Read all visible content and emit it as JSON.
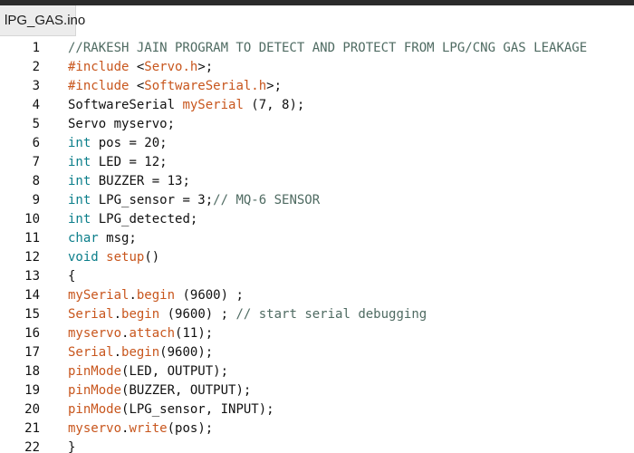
{
  "tab": {
    "title": "lPG_GAS.ino"
  },
  "colors": {
    "comment": "#4f6b62",
    "keyword": "#0b7e8a",
    "function": "#c8561d",
    "plain": "#111111",
    "tab_bg": "#ececec",
    "topbar": "#2b2b2b"
  },
  "lines": [
    {
      "n": "1",
      "tokens": [
        {
          "t": "c",
          "s": "//RAKESH JAIN PROGRAM TO DETECT AND PROTECT FROM LPG/CNG GAS LEAKAGE"
        }
      ]
    },
    {
      "n": "2",
      "tokens": [
        {
          "t": "f",
          "s": "#include"
        },
        {
          "t": "p",
          "s": " <"
        },
        {
          "t": "f",
          "s": "Servo.h"
        },
        {
          "t": "p",
          "s": ">;"
        }
      ]
    },
    {
      "n": "3",
      "tokens": [
        {
          "t": "f",
          "s": "#include"
        },
        {
          "t": "p",
          "s": " <"
        },
        {
          "t": "f",
          "s": "SoftwareSerial.h"
        },
        {
          "t": "p",
          "s": ">;"
        }
      ]
    },
    {
      "n": "4",
      "tokens": [
        {
          "t": "p",
          "s": "SoftwareSerial "
        },
        {
          "t": "f",
          "s": "mySerial"
        },
        {
          "t": "p",
          "s": " (7, 8);"
        }
      ]
    },
    {
      "n": "5",
      "tokens": [
        {
          "t": "p",
          "s": "Servo myservo;"
        }
      ]
    },
    {
      "n": "6",
      "tokens": [
        {
          "t": "k",
          "s": "int"
        },
        {
          "t": "p",
          "s": " pos = 20;"
        }
      ]
    },
    {
      "n": "7",
      "tokens": [
        {
          "t": "k",
          "s": "int"
        },
        {
          "t": "p",
          "s": " LED = 12;"
        }
      ]
    },
    {
      "n": "8",
      "tokens": [
        {
          "t": "k",
          "s": "int"
        },
        {
          "t": "p",
          "s": " BUZZER = 13;"
        }
      ]
    },
    {
      "n": "9",
      "tokens": [
        {
          "t": "k",
          "s": "int"
        },
        {
          "t": "p",
          "s": " LPG_sensor = 3;"
        },
        {
          "t": "c",
          "s": "// MQ-6 SENSOR"
        }
      ]
    },
    {
      "n": "10",
      "tokens": [
        {
          "t": "k",
          "s": "int"
        },
        {
          "t": "p",
          "s": " LPG_detected;"
        }
      ]
    },
    {
      "n": "11",
      "tokens": [
        {
          "t": "k",
          "s": "char"
        },
        {
          "t": "p",
          "s": " msg;"
        }
      ]
    },
    {
      "n": "12",
      "tokens": [
        {
          "t": "k",
          "s": "void"
        },
        {
          "t": "p",
          "s": " "
        },
        {
          "t": "f",
          "s": "setup"
        },
        {
          "t": "p",
          "s": "()"
        }
      ]
    },
    {
      "n": "13",
      "tokens": [
        {
          "t": "p",
          "s": "{"
        }
      ]
    },
    {
      "n": "14",
      "tokens": [
        {
          "t": "f",
          "s": "mySerial"
        },
        {
          "t": "p",
          "s": "."
        },
        {
          "t": "f",
          "s": "begin"
        },
        {
          "t": "p",
          "s": " (9600) ;"
        }
      ]
    },
    {
      "n": "15",
      "tokens": [
        {
          "t": "f",
          "s": "Serial"
        },
        {
          "t": "p",
          "s": "."
        },
        {
          "t": "f",
          "s": "begin"
        },
        {
          "t": "p",
          "s": " (9600) ; "
        },
        {
          "t": "c",
          "s": "// start serial debugging"
        }
      ]
    },
    {
      "n": "16",
      "tokens": [
        {
          "t": "f",
          "s": "myservo"
        },
        {
          "t": "p",
          "s": "."
        },
        {
          "t": "f",
          "s": "attach"
        },
        {
          "t": "p",
          "s": "(11);"
        }
      ]
    },
    {
      "n": "17",
      "tokens": [
        {
          "t": "f",
          "s": "Serial"
        },
        {
          "t": "p",
          "s": "."
        },
        {
          "t": "f",
          "s": "begin"
        },
        {
          "t": "p",
          "s": "(9600);"
        }
      ]
    },
    {
      "n": "18",
      "tokens": [
        {
          "t": "f",
          "s": "pinMode"
        },
        {
          "t": "p",
          "s": "(LED, OUTPUT);"
        }
      ]
    },
    {
      "n": "19",
      "tokens": [
        {
          "t": "f",
          "s": "pinMode"
        },
        {
          "t": "p",
          "s": "(BUZZER, OUTPUT);"
        }
      ]
    },
    {
      "n": "20",
      "tokens": [
        {
          "t": "f",
          "s": "pinMode"
        },
        {
          "t": "p",
          "s": "(LPG_sensor, INPUT);"
        }
      ]
    },
    {
      "n": "21",
      "tokens": [
        {
          "t": "f",
          "s": "myservo"
        },
        {
          "t": "p",
          "s": "."
        },
        {
          "t": "f",
          "s": "write"
        },
        {
          "t": "p",
          "s": "(pos);"
        }
      ]
    },
    {
      "n": "22",
      "tokens": [
        {
          "t": "p",
          "s": "}"
        }
      ]
    }
  ]
}
